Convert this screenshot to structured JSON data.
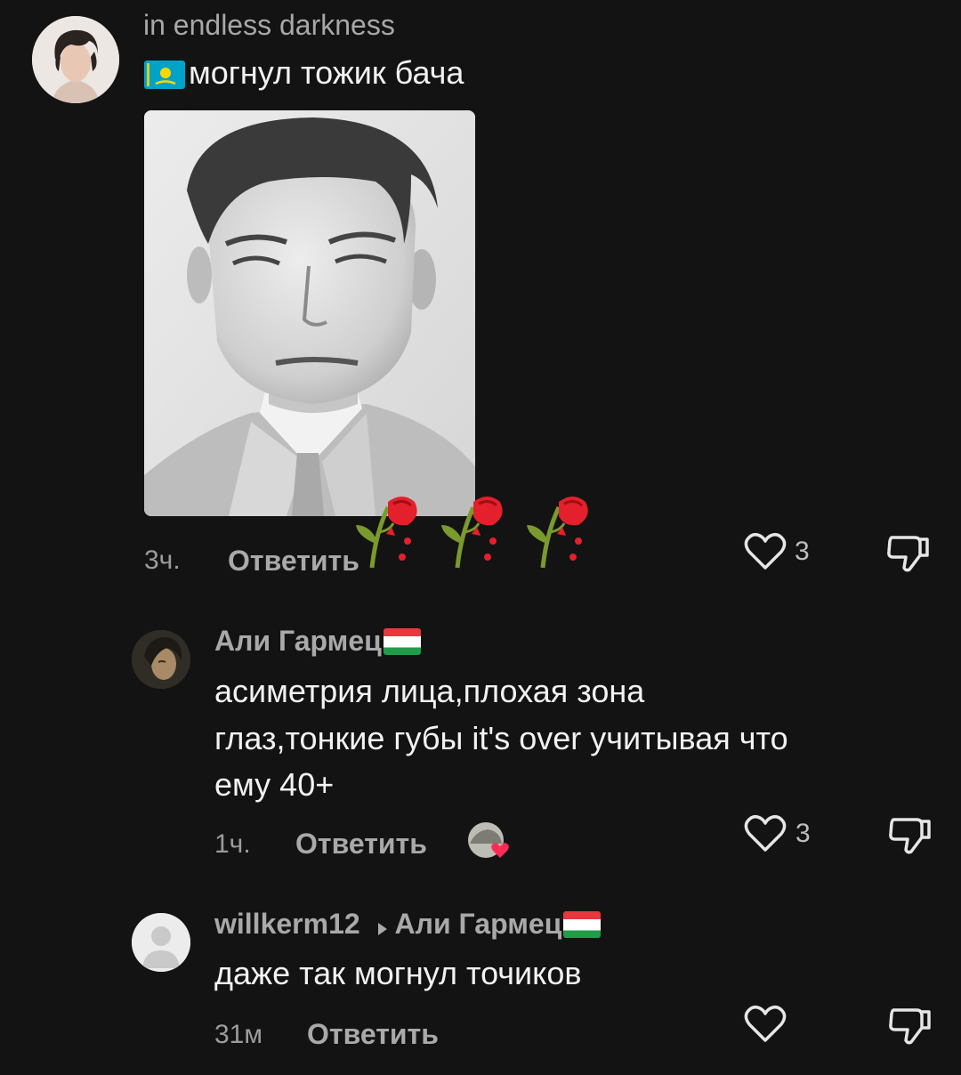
{
  "comments": [
    {
      "username": "in endless darkness",
      "text": "могнул тожик бача",
      "time": "3ч.",
      "reply_label": "Ответить",
      "likes": "3",
      "flag": "kz-flag"
    },
    {
      "username": "Али Гармец",
      "text_lines": [
        "асиметрия лица,плохая зона",
        "глаз,тонкие губы it's over учитывая что",
        "ему 40+"
      ],
      "time": "1ч.",
      "reply_label": "Ответить",
      "likes": "3",
      "flag": "tj-flag"
    },
    {
      "username": "willkerm12",
      "reply_to": "Али Гармец",
      "text": "даже так могнул точиков",
      "time": "31м",
      "reply_label": "Ответить",
      "likes": "",
      "flag": "tj-flag"
    }
  ],
  "icons": {
    "like": "heart-outline-icon",
    "dislike": "thumbs-down-outline-icon",
    "reply_arrow": "triangle-right-icon",
    "rose": "wilted-rose-emoji",
    "default_avatar": "person-silhouette-icon"
  },
  "colors": {
    "background": "#131313",
    "text": "#f2f2f2",
    "muted": "#a9a9a9",
    "rose_red": "#e3202c"
  }
}
